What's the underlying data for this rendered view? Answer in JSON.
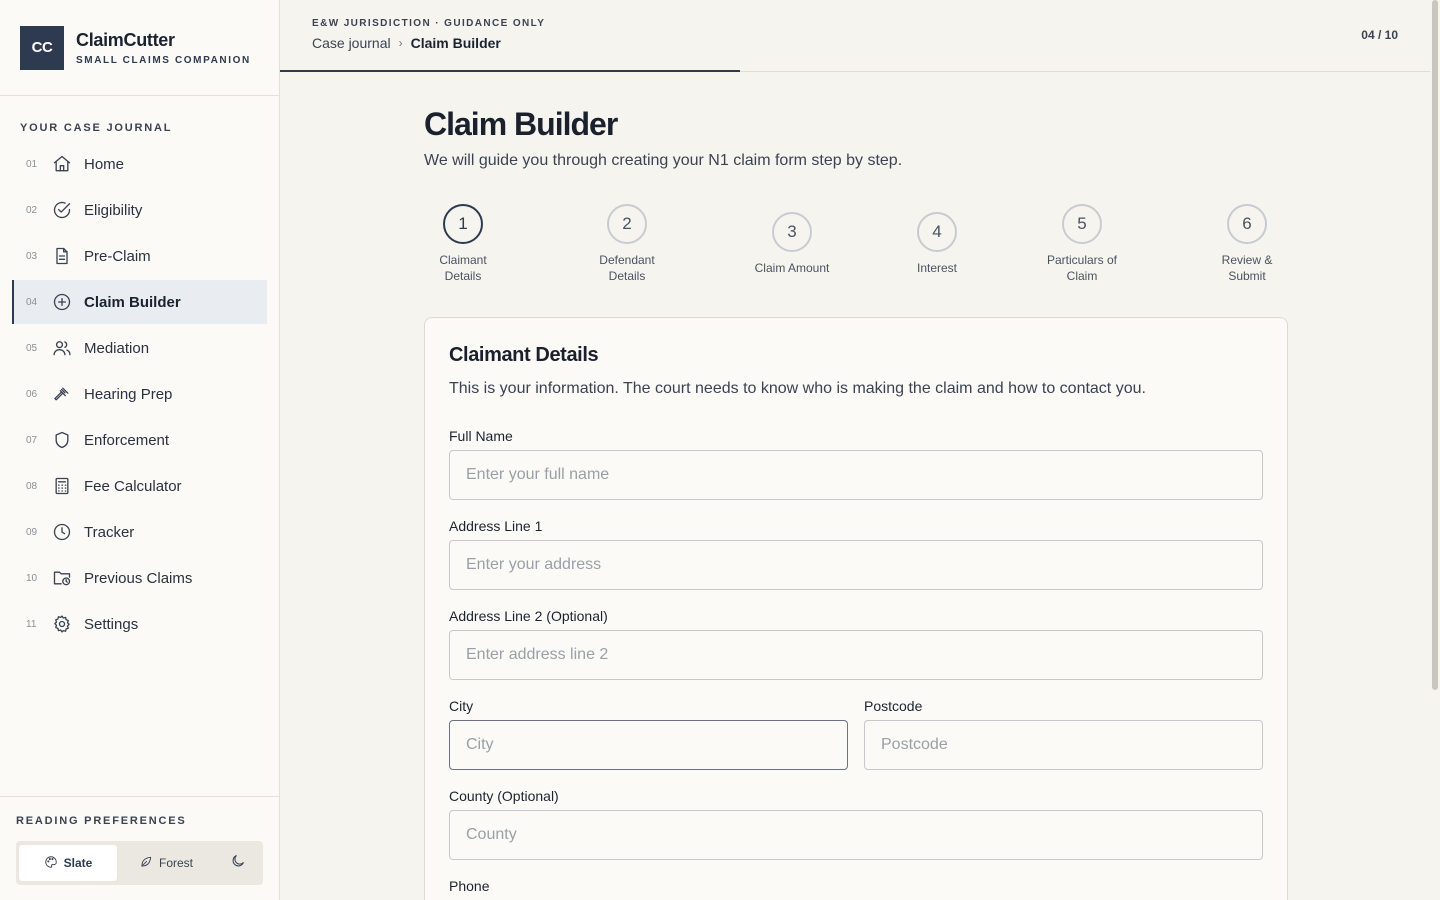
{
  "app": {
    "logo": "CC",
    "name": "ClaimCutter",
    "tagline": "SMALL CLAIMS COMPANION"
  },
  "sidebar": {
    "section_label": "YOUR CASE JOURNAL",
    "items": [
      {
        "num": "01",
        "label": "Home",
        "icon": "home-icon"
      },
      {
        "num": "02",
        "label": "Eligibility",
        "icon": "check-circle-icon"
      },
      {
        "num": "03",
        "label": "Pre-Claim",
        "icon": "document-icon"
      },
      {
        "num": "04",
        "label": "Claim Builder",
        "icon": "plus-circle-icon",
        "active": true
      },
      {
        "num": "05",
        "label": "Mediation",
        "icon": "users-icon"
      },
      {
        "num": "06",
        "label": "Hearing Prep",
        "icon": "gavel-icon"
      },
      {
        "num": "07",
        "label": "Enforcement",
        "icon": "shield-icon"
      },
      {
        "num": "08",
        "label": "Fee Calculator",
        "icon": "calculator-icon"
      },
      {
        "num": "09",
        "label": "Tracker",
        "icon": "clock-icon"
      },
      {
        "num": "10",
        "label": "Previous Claims",
        "icon": "folder-clock-icon"
      },
      {
        "num": "11",
        "label": "Settings",
        "icon": "gear-icon"
      }
    ],
    "preferences_label": "READING PREFERENCES",
    "themes": [
      {
        "label": "Slate",
        "icon": "palette-icon",
        "active": true
      },
      {
        "label": "Forest",
        "icon": "leaf-icon",
        "active": false
      }
    ],
    "dark_mode_icon": "moon-icon"
  },
  "topbar": {
    "jurisdiction": "E&W JURISDICTION · GUIDANCE ONLY",
    "breadcrumb_parent": "Case journal",
    "breadcrumb_current": "Claim Builder",
    "step_count": "04 / 10",
    "progress": 0.4
  },
  "page": {
    "title": "Claim Builder",
    "subtitle": "We will guide you through creating your N1 claim form step by step."
  },
  "stepper": {
    "steps": [
      {
        "num": "1",
        "label": "Claimant Details",
        "active": true
      },
      {
        "num": "2",
        "label": "Defendant Details",
        "active": false
      },
      {
        "num": "3",
        "label": "Claim Amount",
        "active": false
      },
      {
        "num": "4",
        "label": "Interest",
        "active": false
      },
      {
        "num": "5",
        "label": "Particulars of Claim",
        "active": false
      },
      {
        "num": "6",
        "label": "Review & Submit",
        "active": false
      }
    ]
  },
  "form": {
    "title": "Claimant Details",
    "description": "This is your information. The court needs to know who is making the claim and how to contact you.",
    "full_name": {
      "label": "Full Name",
      "placeholder": "Enter your full name",
      "value": ""
    },
    "address1": {
      "label": "Address Line 1",
      "placeholder": "Enter your address",
      "value": ""
    },
    "address2": {
      "label": "Address Line 2 (Optional)",
      "placeholder": "Enter address line 2",
      "value": ""
    },
    "city": {
      "label": "City",
      "placeholder": "City",
      "value": ""
    },
    "postcode": {
      "label": "Postcode",
      "placeholder": "Postcode",
      "value": ""
    },
    "county": {
      "label": "County (Optional)",
      "placeholder": "County",
      "value": ""
    },
    "phone": {
      "label": "Phone"
    }
  }
}
